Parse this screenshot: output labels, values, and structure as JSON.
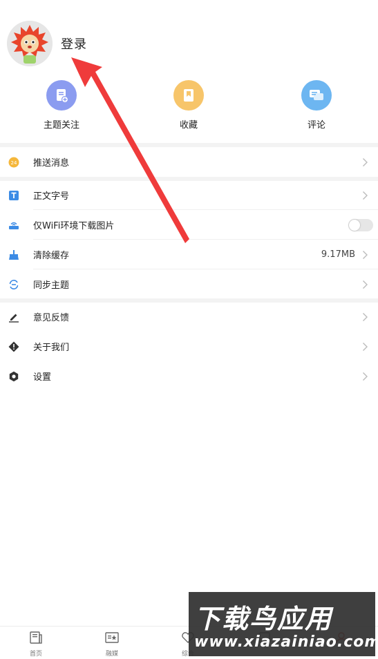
{
  "header": {
    "login_label": "登录"
  },
  "quick_actions": [
    {
      "label": "主题关注",
      "icon": "doc-add-icon",
      "color": "#8b9cf0"
    },
    {
      "label": "收藏",
      "icon": "bookmark-icon",
      "color": "#f7c56a"
    },
    {
      "label": "评论",
      "icon": "comment-icon",
      "color": "#6db6f1"
    }
  ],
  "menu": {
    "push": {
      "label": "推送消息",
      "icon": "clock-24-icon"
    },
    "font_size": {
      "label": "正文字号",
      "icon": "text-t-icon"
    },
    "wifi_images": {
      "label": "仅WiFi环境下载图片",
      "icon": "router-icon",
      "enabled": false
    },
    "clear_cache": {
      "label": "清除缓存",
      "icon": "broom-icon",
      "value": "9.17MB"
    },
    "sync_topics": {
      "label": "同步主题",
      "icon": "sync-icon"
    },
    "feedback": {
      "label": "意见反馈",
      "icon": "pencil-icon"
    },
    "about": {
      "label": "关于我们",
      "icon": "info-diamond-icon"
    },
    "settings": {
      "label": "设置",
      "icon": "gear-icon"
    }
  },
  "bottom_nav": [
    {
      "label": "首页",
      "icon": "news-icon"
    },
    {
      "label": "融媒",
      "icon": "media-icon"
    },
    {
      "label": "综合",
      "icon": "heart-icon"
    },
    {
      "label": "",
      "icon": "grid-icon"
    },
    {
      "label": "",
      "icon": "user-icon"
    }
  ],
  "watermark": {
    "title": "下载鸟应用",
    "url": "www.xiazainiao.com"
  },
  "colors": {
    "accent_arrow": "#ef3b3b",
    "divider": "#efefef",
    "gap": "#f3f3f3"
  }
}
